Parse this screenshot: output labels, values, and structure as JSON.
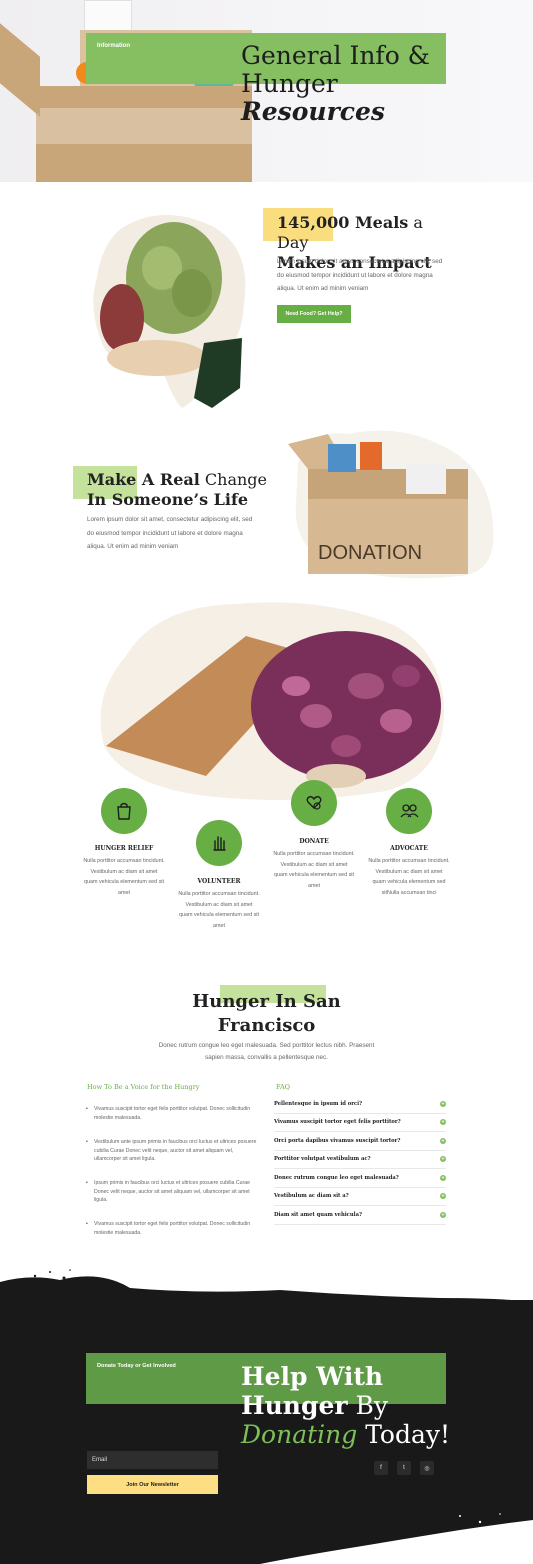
{
  "hero": {
    "label": "Information",
    "title_line1": "General Info &",
    "title_line2": "Hunger",
    "title_line3": "Resources"
  },
  "meals": {
    "title_bold": "145,000 Meals",
    "title_light": " a Day",
    "title_line2": "Makes an Impact",
    "body": "Lorem ipsum dolor sit amet, consectetur adipiscing elit, sed do eiusmod tempor incididunt ut labore et dolore magna aliqua. Ut enim ad minim veniam",
    "button": "Need Food? Get Help?"
  },
  "change": {
    "title_bold": "Make A Real",
    "title_light": " Change",
    "title_line2": "In Someone’s Life",
    "body": "Lorem ipsum dolor sit amet, consectetur adipiscing elit, sed do eiusmod tempor incididunt ut labore et dolore magna aliqua. Ut enim ad minim veniam",
    "image_text": "DONATION"
  },
  "features": [
    {
      "title": "HUNGER RELIEF",
      "text": "Nulla porttitor accumsan tincidunt. Vestibulum ac diam sit amet quam vehicula elementum sed sit amet",
      "icon": "shopping-bag-icon"
    },
    {
      "title": "VOLUNTEER",
      "text": "Nulla porttitor accumsan tincidunt. Vestibulum ac diam sit amet quam vehicula elementum sed sit amet",
      "icon": "hand-icon"
    },
    {
      "title": "DONATE",
      "text": "Nulla porttitor accumsan tincidunt. Vestibulum ac diam sit amet quam vehicula elementum sed sit amet",
      "icon": "heart-hand-icon"
    },
    {
      "title": "ADVOCATE",
      "text": "Nulla porttitor accumsan tincidunt. Vestibulum ac diam sit amet quam vehicula elementum sed sitNulla accumsan tinci",
      "icon": "people-icon"
    }
  ],
  "sf": {
    "title_line1": "Hunger In San",
    "title_line2": "Francisco",
    "subtitle": "Donec rutrum congue leo eget malesuada. Sed porttitor lectus nibh. Praesent sapien massa, convallis a pellentesque nec.",
    "voice_heading": "How To Be a Voice for the Hungry",
    "bullets": [
      "Vivamus suscipit tortor eget felis porttitor volutpat. Donec sollicitudin molestie malesuada.",
      "Vestibulum ante ipsum primis in faucibus orci luctus et ultrices posuere cubilia Curae Donec velit neque, auctor sit amet aliquam vel, ullamcorper sit amet ligula.",
      "Ipsum primis in faucibus orci luctus et ultrices posuere cubilia Curae Donec velit neque, auctor sit amet aliquam vel, ullamcorper sit amet ligula.",
      "Vivamus suscipit tortor eget felis porttitor volutpat. Donec sollicitudin molestie malesuada."
    ],
    "faq_heading": "FAQ",
    "faqs": [
      "Pellentesque in ipsum id orci?",
      "Vivamus suscipit tortor eget felis porttitor?",
      "Orci porta dapibus vivamus suscipit tortor?",
      "Porttitor volutpat vestibulum ac?",
      "Donec rutrum congue leo eget malesuada?",
      "Vestibulum ac diam sit a?",
      "Diam sit amet quam vehicula?"
    ]
  },
  "footer": {
    "label": "Donate Today or Get Involved",
    "title_bold1": "Help With",
    "title_bold2": "Hunger",
    "title_by": " By",
    "title_donating": "Donating",
    "title_today": " Today!",
    "email_placeholder": "Email",
    "newsletter_button": "Join Our Newsletter",
    "social": [
      "f",
      "t",
      "◎"
    ]
  },
  "colors": {
    "accent_green": "#67ae45",
    "light_green": "#c4e29b",
    "yellow": "#fdde83",
    "dark": "#191919"
  }
}
